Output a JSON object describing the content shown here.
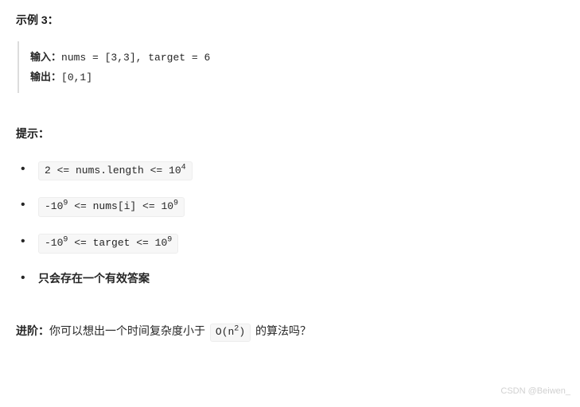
{
  "example": {
    "heading": "示例 3：",
    "input_label": "输入：",
    "input_value": "nums = [3,3], target = 6",
    "output_label": "输出：",
    "output_value": "[0,1]"
  },
  "hints_heading": "提示：",
  "hints": {
    "c1_pre": "2 <= nums.length <= 10",
    "c1_sup": "4",
    "c2_pre1": "-10",
    "c2_sup1": "9",
    "c2_mid": " <= nums[i] <= 10",
    "c2_sup2": "9",
    "c3_pre1": "-10",
    "c3_sup1": "9",
    "c3_mid": " <= target <= 10",
    "c3_sup2": "9",
    "c4": "只会存在一个有效答案"
  },
  "advanced": {
    "lead": "进阶：",
    "text_before": "你可以想出一个时间复杂度小于 ",
    "code_main": "O(n",
    "code_sup": "2",
    "code_close": ")",
    "text_after": " 的算法吗？"
  },
  "watermark": "CSDN @Beiwen_"
}
